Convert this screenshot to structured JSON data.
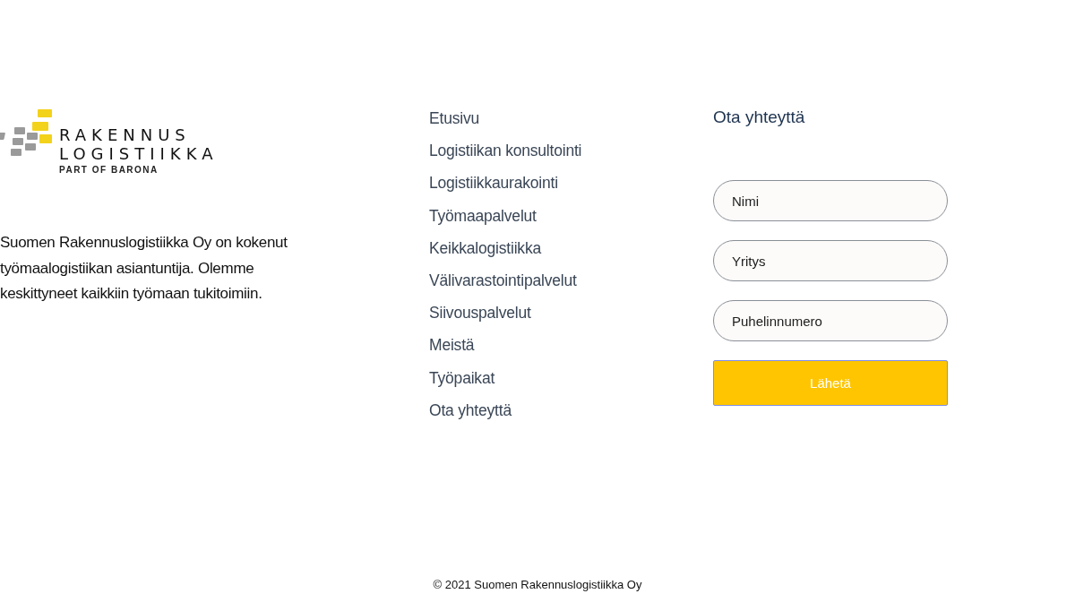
{
  "logo": {
    "line_1": "RAKENNUS",
    "line_2": "LOGISTIIKKA",
    "tagline": "PART OF BARONA"
  },
  "description": "Suomen Rakennuslogistiikka Oy on kokenut työmaalogistiikan asiantuntija. Olemme keskittyneet kaikkiin työmaan tukitoimiin.",
  "nav": [
    "Etusivu",
    "Logistiikan konsultointi",
    "Logistiikkaurakointi",
    "Työmaapalvelut",
    "Keikkalogistiikka",
    "Välivarastointipalvelut",
    "Siivouspalvelut",
    "Meistä",
    "Työpaikat",
    "Ota yhteyttä"
  ],
  "contact": {
    "heading": "Ota yhteyttä",
    "fields": [
      {
        "placeholder": "Nimi"
      },
      {
        "placeholder": "Yritys"
      },
      {
        "placeholder": "Puhelinnumero"
      }
    ],
    "submit": "Lähetä"
  },
  "footer": "© 2021 Suomen Rakennuslogistiikka Oy"
}
